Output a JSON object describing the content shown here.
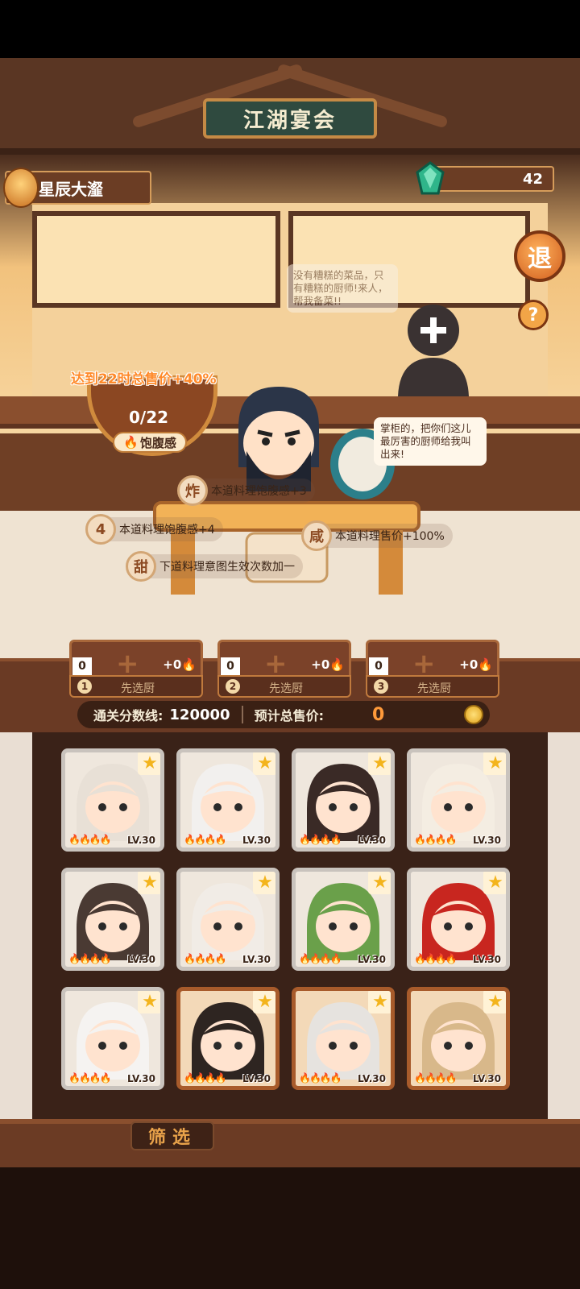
{
  "header": {
    "title": "江湖宴会",
    "player_name": "星辰大瀣",
    "gem_count": "42",
    "exit_label": "退",
    "help_label": "?"
  },
  "scene": {
    "speech_top": "没有糟糕的菜品，只有糟糕的厨师!来人，帮我备菜!!",
    "speech_chef": "掌柜的，把你们这儿最厉害的厨师给我叫出来!",
    "satiety_goal": "达到22时总售价+40%",
    "satiety_count": "0/22",
    "satiety_label": "饱腹感",
    "effects": [
      {
        "badge": "炸",
        "text": "本道料理饱腹感+3"
      },
      {
        "badge": "4",
        "text": "本道料理饱腹感+4"
      },
      {
        "badge": "咸",
        "text": "本道料理售价+100%"
      },
      {
        "badge": "甜",
        "text": "下道料理意图生效次数加一"
      }
    ]
  },
  "slots": [
    {
      "count": "0",
      "bonus": "+0",
      "num": "1",
      "label": "先选厨"
    },
    {
      "count": "0",
      "bonus": "+0",
      "num": "2",
      "label": "先选厨"
    },
    {
      "count": "0",
      "bonus": "+0",
      "num": "3",
      "label": "先选厨"
    }
  ],
  "score": {
    "pass_label": "通关分数线:",
    "pass_value": "120000",
    "total_label": "预计总售价:",
    "total_value": "0"
  },
  "chefs": [
    {
      "level": "LV.30",
      "frame": "grey",
      "hair": "#e8e0d6",
      "skin": "#ffe3cf"
    },
    {
      "level": "LV.30",
      "frame": "grey",
      "hair": "#f2f0ee",
      "skin": "#ffe3cf"
    },
    {
      "level": "LV.30",
      "frame": "grey",
      "hair": "#3a2a26",
      "skin": "#ffe3cf"
    },
    {
      "level": "LV.30",
      "frame": "grey",
      "hair": "#f4ede2",
      "skin": "#ffe3cf"
    },
    {
      "level": "LV.30",
      "frame": "grey",
      "hair": "#4a3a33",
      "skin": "#ffe3cf"
    },
    {
      "level": "LV.30",
      "frame": "grey",
      "hair": "#f1ece6",
      "skin": "#ffe3cf"
    },
    {
      "level": "LV.30",
      "frame": "grey",
      "hair": "#6aa04a",
      "skin": "#ffe3cf"
    },
    {
      "level": "LV.30",
      "frame": "grey",
      "hair": "#c8261f",
      "skin": "#ffe3cf"
    },
    {
      "level": "LV.30",
      "frame": "grey",
      "hair": "#f5f3f1",
      "skin": "#ffe3cf"
    },
    {
      "level": "LV.30",
      "frame": "brown",
      "hair": "#2e2521",
      "skin": "#ffe3cf"
    },
    {
      "level": "LV.30",
      "frame": "brown",
      "hair": "#e6e3df",
      "skin": "#ffe3cf"
    },
    {
      "level": "LV.30",
      "frame": "brown",
      "hair": "#d8b88a",
      "skin": "#ffe3cf"
    }
  ],
  "filter_label": "筛选",
  "colors": {
    "accent": "#ff8a2a",
    "wood": "#6b3d24",
    "gold": "#f3b41c"
  }
}
